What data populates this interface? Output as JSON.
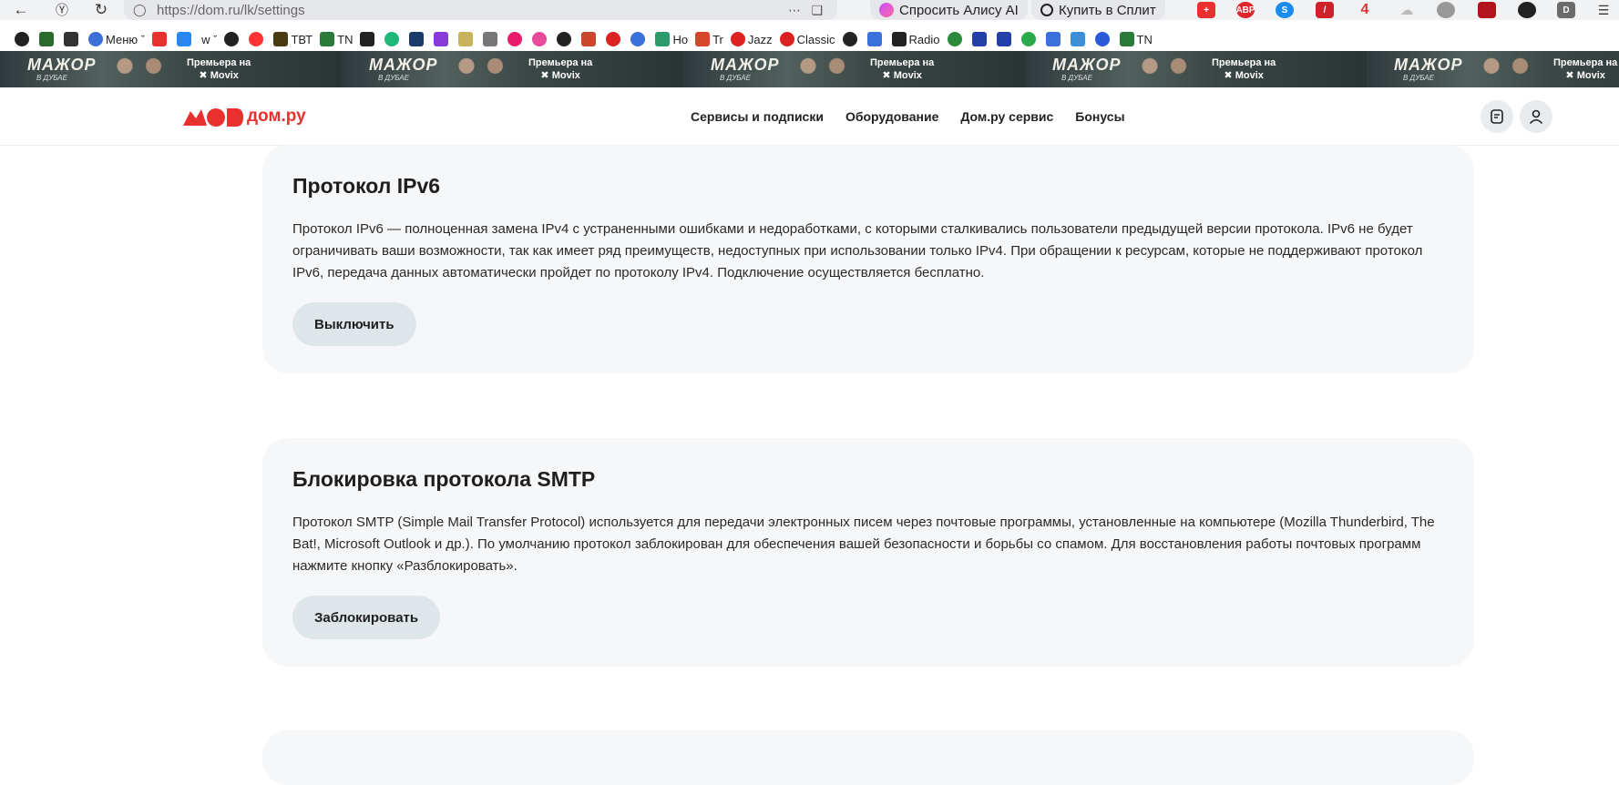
{
  "browser": {
    "url": "https://dom.ru/lk/settings",
    "alice_label": "Спросить Алису AI",
    "split_label": "Купить в Сплит"
  },
  "bookmarks": [
    "Меню",
    "w",
    "ТВТ",
    "TN",
    "Но",
    "Tr",
    "Jazz",
    "Classic",
    "Radio",
    "TN"
  ],
  "banner": {
    "title": "МАЖОР",
    "subtitle": "В ДУБАЕ",
    "tag_line1": "Премьера на",
    "tag_line2": "Movix"
  },
  "header": {
    "logo_text": "дом.ру",
    "nav": [
      "Сервисы и подписки",
      "Оборудование",
      "Дом.ру сервис",
      "Бонусы"
    ]
  },
  "cards": [
    {
      "title": "Протокол IPv6",
      "text": "Протокол IPv6 — полноценная замена IPv4 с устраненными ошибками и недоработками, с которыми сталкивались пользователи предыдущей версии протокола. IPv6 не будет ограничивать ваши возможности, так как имеет ряд преимуществ, недоступных при использовании только IPv4. При обращении к ресурсам, которые не поддерживают протокол IPv6, передача данных автоматически пройдет по протоколу IPv4. Подключение осуществляется бесплатно.",
      "button": "Выключить"
    },
    {
      "title": "Блокировка протокола SMTP",
      "text": "Протокол SMTP (Simple Mail Transfer Protocol) используется для передачи электронных писем через почтовые программы, установленные на компьютере (Mozilla Thunderbird, The Bat!, Microsoft Outlook и др.). По умолчанию протокол заблокирован для обеспечения вашей безопасности и борьбы со спамом. Для восстановления работы почтовых программ нажмите кнопку «Разблокировать».",
      "button": "Заблокировать"
    }
  ],
  "colors": {
    "brand_red": "#e8312f",
    "card_bg": "#f6f7f8",
    "button_bg": "#dfe6ea"
  }
}
